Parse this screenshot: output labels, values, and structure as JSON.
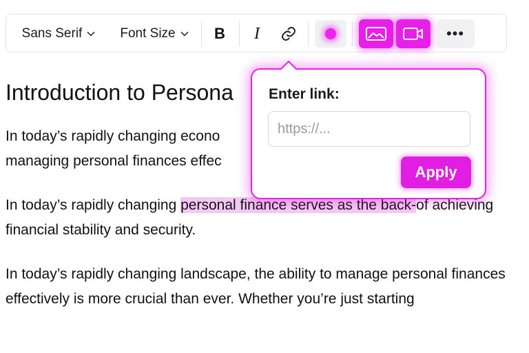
{
  "toolbar": {
    "font_family": "Sans Serif",
    "font_size": "Font Size",
    "bold_label": "B",
    "italic_label": "I",
    "more_label": "•••",
    "accent_color": "#e81fe8",
    "text_color_swatch": "#ee22ee",
    "icons": [
      "chevron-down-icon",
      "link-icon",
      "image-icon",
      "video-icon",
      "more-icon"
    ]
  },
  "document": {
    "title": "Introduction to Persona",
    "paragraphs": [
      {
        "text": "In today’s rapidly changing econo",
        "text_line2": "managing personal finances effec"
      },
      {
        "text_before": "In today’s rapidly changing ",
        "highlight": "personal finance serves as the back-",
        "text_after": "of achieving financial stability and security.",
        "highlight_color": "#f4c8f4"
      },
      {
        "text": "In today’s rapidly changing landscape, the ability to manage personal finances effectively is more crucial than ever. Whether you’re just starting"
      }
    ]
  },
  "link_popover": {
    "label": "Enter link:",
    "placeholder": "https://...",
    "value": "",
    "apply_label": "Apply"
  }
}
